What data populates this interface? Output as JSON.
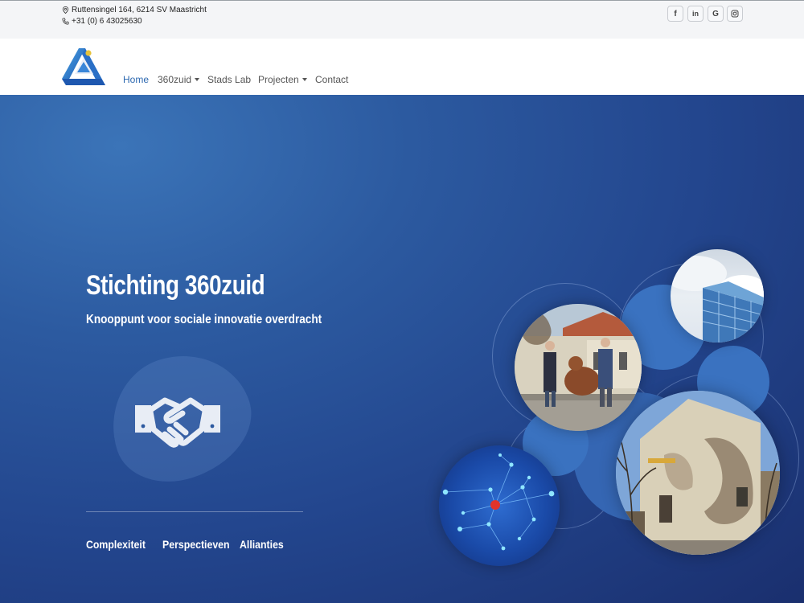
{
  "topbar": {
    "address": "Ruttensingel 164, 6214 SV Maastricht",
    "phone": "+31 (0) 6 43025630",
    "social": [
      {
        "label": "f",
        "icon": "facebook-icon"
      },
      {
        "label": "in",
        "icon": "linkedin-icon"
      },
      {
        "label": "G",
        "icon": "google-icon"
      },
      {
        "label": "instagram",
        "icon": "instagram-icon"
      }
    ]
  },
  "nav": {
    "items": [
      {
        "label": "Home",
        "active": true
      },
      {
        "label": "360zuid",
        "dropdown": true
      },
      {
        "label": "Stads Lab"
      },
      {
        "label": "Projecten",
        "dropdown": true
      },
      {
        "label": "Contact"
      }
    ]
  },
  "hero": {
    "title": "Stichting 360zuid",
    "subtitle": "Knooppunt voor sociale innovatie overdracht",
    "links": [
      "Complexiteit",
      "Perspectieven",
      "Allianties"
    ]
  },
  "colors": {
    "accent": "#2c68b0",
    "hero_dark": "#1a2f6e",
    "hero_light": "#3b74b8",
    "circle_blue": "#3a72c0",
    "logo_yellow": "#e6c23a"
  }
}
